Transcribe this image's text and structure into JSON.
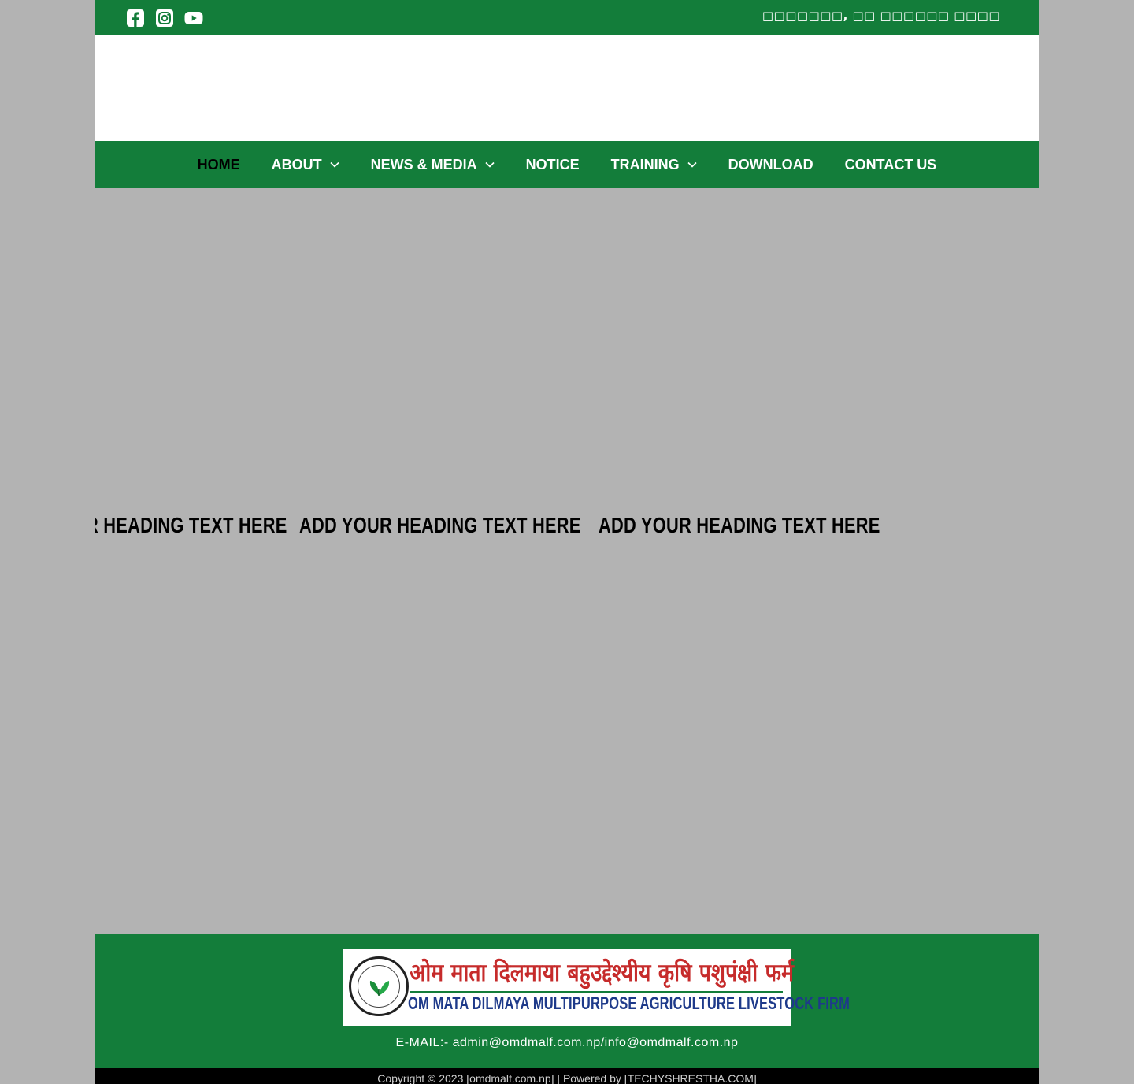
{
  "colors": {
    "brand_green": "#137d3a",
    "page_bg": "#b3b3b3",
    "footer_bottom": "#000000"
  },
  "topbar": {
    "social_icons": [
      "facebook-icon",
      "instagram-icon",
      "youtube-icon"
    ],
    "date_text": "□□□□□□□, □□ □□□□□□ □□□□"
  },
  "nav": {
    "items": [
      {
        "label": "HOME",
        "active": true,
        "dropdown": false
      },
      {
        "label": "ABOUT",
        "active": false,
        "dropdown": true
      },
      {
        "label": "NEWS & MEDIA",
        "active": false,
        "dropdown": true
      },
      {
        "label": "NOTICE",
        "active": false,
        "dropdown": false
      },
      {
        "label": "TRAINING",
        "active": false,
        "dropdown": true
      },
      {
        "label": "DOWNLOAD",
        "active": false,
        "dropdown": false
      },
      {
        "label": "CONTACT US",
        "active": false,
        "dropdown": false
      }
    ]
  },
  "headings": [
    "Add Your Heading Text Here",
    "Add Your Heading Text Here",
    "Add Your Heading Text Here"
  ],
  "footer": {
    "logo_nepali": "ओम माता दिलमाया बहुउद्देश्यीय कृषि पशुपंक्षी फर्म",
    "logo_english": "OM MATA DILMAYA MULTIPURPOSE  AGRICULTURE LIVESTOCK FIRM",
    "email": "E-MAIL:- admin@omdmalf.com.np/info@omdmalf.com.np",
    "copyright": "Copyright © 2023 [omdmalf.com.np] | Powered by [TECHYSHRESTHA.COM]"
  }
}
